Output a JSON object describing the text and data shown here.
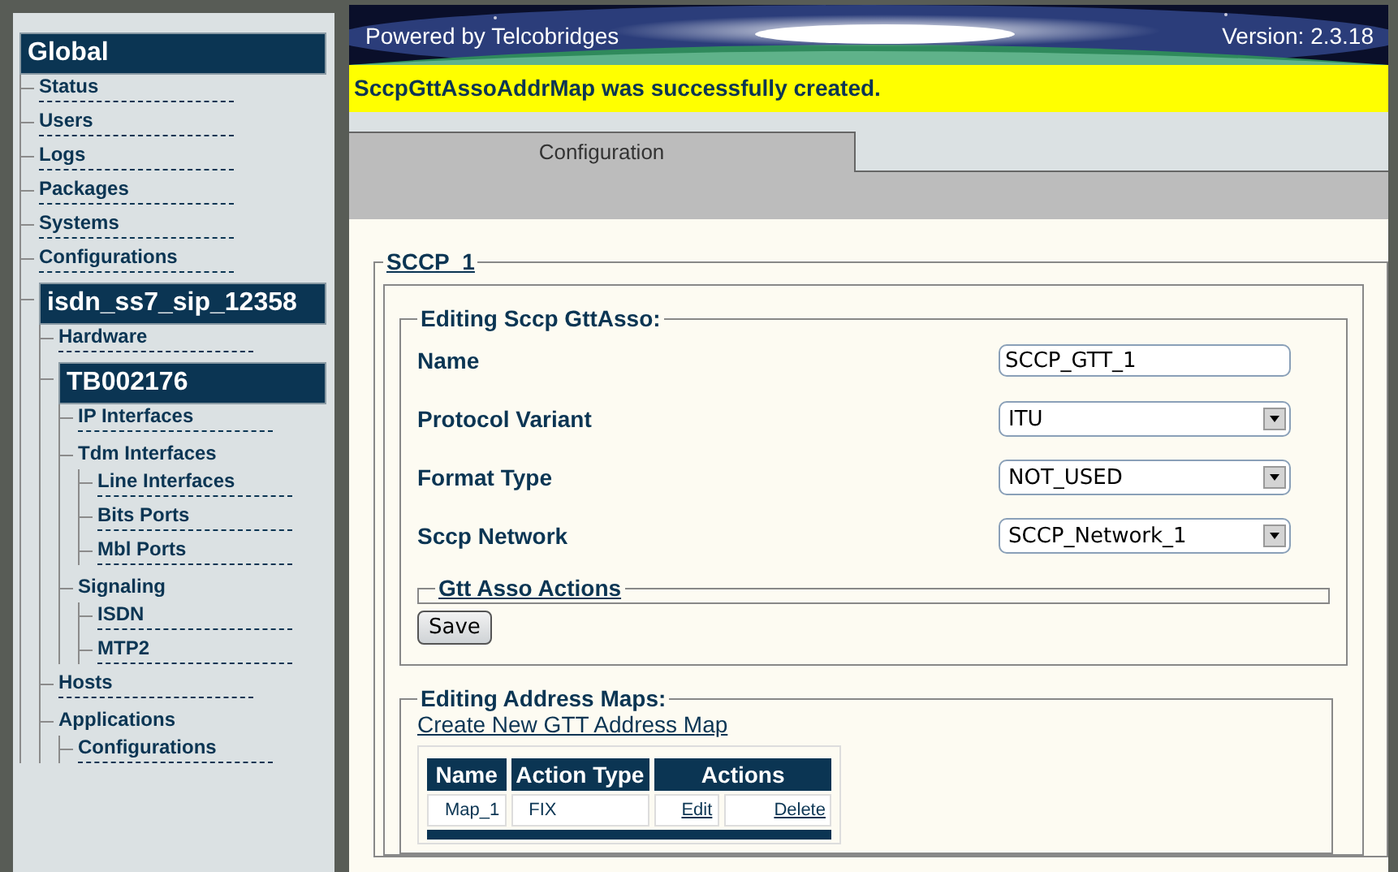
{
  "sidebar": {
    "tree": [
      {
        "label": "Global",
        "kind": "header",
        "children": [
          {
            "label": "Status",
            "kind": "link"
          },
          {
            "label": "Users",
            "kind": "link"
          },
          {
            "label": "Logs",
            "kind": "link"
          },
          {
            "label": "Packages",
            "kind": "link"
          },
          {
            "label": "Systems",
            "kind": "link"
          },
          {
            "label": "Configurations",
            "kind": "link"
          },
          {
            "label": "isdn_ss7_sip_12358",
            "kind": "header",
            "children": [
              {
                "label": "Hardware",
                "kind": "link"
              },
              {
                "label": "TB002176",
                "kind": "header",
                "children": [
                  {
                    "label": "IP Interfaces",
                    "kind": "link"
                  },
                  {
                    "label": "Tdm Interfaces",
                    "kind": "group",
                    "children": [
                      {
                        "label": "Line Interfaces",
                        "kind": "link"
                      },
                      {
                        "label": "Bits Ports",
                        "kind": "link"
                      },
                      {
                        "label": "Mbl Ports",
                        "kind": "link"
                      }
                    ]
                  },
                  {
                    "label": "Signaling",
                    "kind": "group",
                    "children": [
                      {
                        "label": "ISDN",
                        "kind": "link"
                      },
                      {
                        "label": "MTP2",
                        "kind": "link"
                      }
                    ]
                  }
                ]
              },
              {
                "label": "Hosts",
                "kind": "link"
              },
              {
                "label": "Applications",
                "kind": "group",
                "children": [
                  {
                    "label": "Configurations",
                    "kind": "link"
                  }
                ]
              }
            ]
          }
        ]
      }
    ]
  },
  "banner": {
    "left": "Powered by Telcobridges",
    "right": "Version: 2.3.18"
  },
  "notice": "SccpGttAssoAddrMap was successfully created.",
  "tabs": [
    {
      "label": "Configuration",
      "selected": true
    }
  ],
  "section": {
    "title": "SCCP_1",
    "form": {
      "title": "Editing Sccp GttAsso:",
      "fields": [
        {
          "label": "Name",
          "kind": "text",
          "value": "SCCP_GTT_1"
        },
        {
          "label": "Protocol Variant",
          "kind": "select",
          "value": "ITU"
        },
        {
          "label": "Format Type",
          "kind": "select",
          "value": "NOT_USED"
        },
        {
          "label": "Sccp Network",
          "kind": "select",
          "value": "SCCP_Network_1"
        }
      ],
      "actions_title": "Gtt Asso Actions",
      "save": "Save"
    },
    "maps": {
      "title": "Editing Address Maps:",
      "create_link": "Create New GTT Address Map",
      "table": {
        "columns": [
          "Name",
          "Action Type",
          "Actions"
        ],
        "rows": [
          {
            "name": "Map_1",
            "action_type": "FIX",
            "edit": "Edit",
            "delete": "Delete"
          }
        ]
      }
    }
  }
}
